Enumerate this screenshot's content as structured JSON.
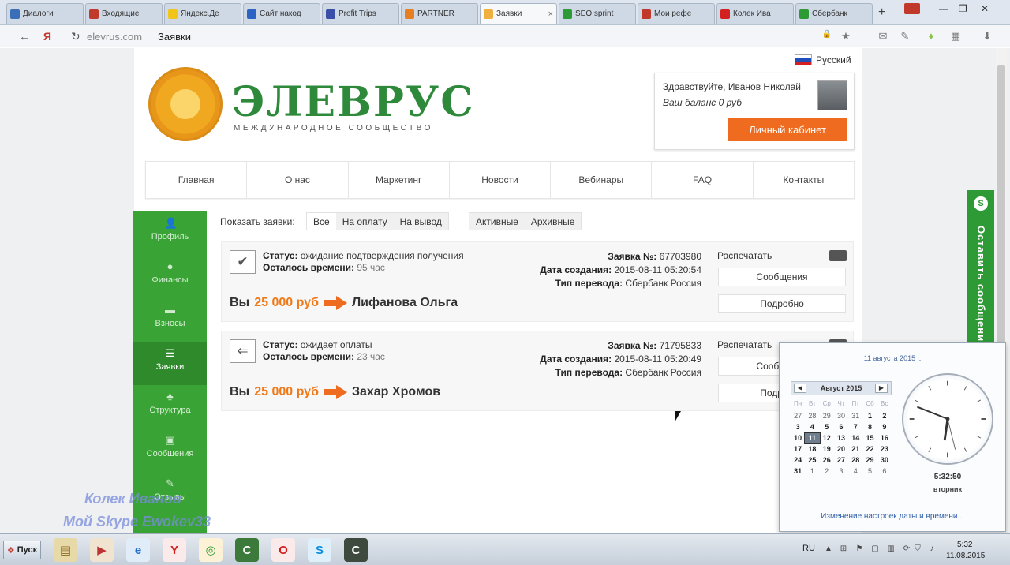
{
  "tabs": [
    {
      "label": "Диалоги",
      "color": "#3a6fb8"
    },
    {
      "label": "Входящие",
      "color": "#c0392b"
    },
    {
      "label": "Яндекс.Де",
      "color": "#f0c419"
    },
    {
      "label": "Сайт накод",
      "color": "#2b64c4"
    },
    {
      "label": "Profit Trips",
      "color": "#3b4fa8"
    },
    {
      "label": "PARTNER",
      "color": "#e67e22"
    },
    {
      "label": "Заявки",
      "color": "#f0b040"
    },
    {
      "label": "SEO sprint",
      "color": "#2e9a35"
    },
    {
      "label": "Мои рефе",
      "color": "#c0392b"
    },
    {
      "label": "Колек Ива",
      "color": "#d32020"
    },
    {
      "label": "Сбербанк",
      "color": "#2e9a35"
    }
  ],
  "active_tab_close": "×",
  "new_tab": "+",
  "window_buttons": {
    "minimize": "—",
    "restore": "❐",
    "close": "✕"
  },
  "address": {
    "back": "←",
    "ya": "Я",
    "reload": "↻",
    "domain": "elevrus.com",
    "title": "Заявки",
    "lock": "🔒",
    "star": "★",
    "download": "⬇"
  },
  "site": {
    "language": "Русский",
    "logo_name": "ЭЛЕВРУС",
    "logo_subtitle": "МЕЖДУНАРОДНОЕ СООБЩЕСТВО",
    "greeting": "Здравствуйте, Иванов Николай",
    "balance": "Ваш баланс 0 руб",
    "cabinet_button": "Личный кабинет",
    "nav": [
      "Главная",
      "О нас",
      "Маркетинг",
      "Новости",
      "Вебинары",
      "FAQ",
      "Контакты"
    ],
    "sidebar": [
      {
        "label": "Профиль",
        "icon": "person-icon",
        "glyph": "👤"
      },
      {
        "label": "Финансы",
        "icon": "coin-icon",
        "glyph": "●"
      },
      {
        "label": "Взносы",
        "icon": "card-icon",
        "glyph": "▬"
      },
      {
        "label": "Заявки",
        "icon": "list-icon",
        "glyph": "☰"
      },
      {
        "label": "Структура",
        "icon": "structure-icon",
        "glyph": "♣"
      },
      {
        "label": "Сообщения",
        "icon": "messages-icon",
        "glyph": "▣"
      },
      {
        "label": "Отзывы",
        "icon": "pen-icon",
        "glyph": "✎"
      }
    ],
    "active_sidebar": "Заявки",
    "filter_label": "Показать заявки:",
    "filter_type": [
      "Все",
      "На оплату",
      "На вывод"
    ],
    "filter_state": [
      "Активные",
      "Архивные"
    ],
    "orders": [
      {
        "status_label": "Статус:",
        "status": "ожидание подтверждения получения",
        "time_label": "Осталось времени:",
        "time": "95 час",
        "you": "Вы",
        "amount": "25 000 руб",
        "recipient": "Лифанова Ольга",
        "number_label": "Заявка №:",
        "number": "67703980",
        "created_label": "Дата создания:",
        "created": "2015-08-11 05:20:54",
        "transfer_label": "Тип перевода:",
        "transfer": "Сбербанк Россия",
        "print": "Распечатать",
        "messages_btn": "Сообщения",
        "details_btn": "Подробно",
        "icon": "check-icon",
        "glyph": "✔"
      },
      {
        "status_label": "Статус:",
        "status": "ожидает оплаты",
        "time_label": "Осталось времени:",
        "time": "23 час",
        "you": "Вы",
        "amount": "25 000 руб",
        "recipient": "Захар Хромов",
        "number_label": "Заявка №:",
        "number": "71795833",
        "created_label": "Дата создания:",
        "created": "2015-08-11 05:20:49",
        "transfer_label": "Тип перевода:",
        "transfer": "Сбербанк Россия",
        "print": "Распечатать",
        "messages_btn": "Сообщения",
        "details_btn": "Подробно",
        "icon": "reply-arrow-icon",
        "glyph": "⇐"
      }
    ],
    "feedback_tab": "Оставить сообщение",
    "feedback_icon": "S"
  },
  "watermark": {
    "line1": "Колек Иванов",
    "line2": "Мой Skype Ewokev33"
  },
  "calendar": {
    "date_header": "11 августа 2015 г.",
    "month": "Август 2015",
    "prev": "◀",
    "next": "▶",
    "weekdays": [
      "Пн",
      "Вт",
      "Ср",
      "Чт",
      "Пт",
      "Сб",
      "Вс"
    ],
    "days": [
      {
        "d": "27",
        "other": true
      },
      {
        "d": "28",
        "other": true
      },
      {
        "d": "29",
        "other": true
      },
      {
        "d": "30",
        "other": true
      },
      {
        "d": "31",
        "other": true
      },
      {
        "d": "1"
      },
      {
        "d": "2"
      },
      {
        "d": "3"
      },
      {
        "d": "4"
      },
      {
        "d": "5"
      },
      {
        "d": "6"
      },
      {
        "d": "7"
      },
      {
        "d": "8"
      },
      {
        "d": "9"
      },
      {
        "d": "10"
      },
      {
        "d": "11",
        "today": true
      },
      {
        "d": "12"
      },
      {
        "d": "13"
      },
      {
        "d": "14"
      },
      {
        "d": "15"
      },
      {
        "d": "16"
      },
      {
        "d": "17"
      },
      {
        "d": "18"
      },
      {
        "d": "19"
      },
      {
        "d": "20"
      },
      {
        "d": "21"
      },
      {
        "d": "22"
      },
      {
        "d": "23"
      },
      {
        "d": "24"
      },
      {
        "d": "25"
      },
      {
        "d": "26"
      },
      {
        "d": "27"
      },
      {
        "d": "28"
      },
      {
        "d": "29"
      },
      {
        "d": "30"
      },
      {
        "d": "31"
      },
      {
        "d": "1",
        "other": true
      },
      {
        "d": "2",
        "other": true
      },
      {
        "d": "3",
        "other": true
      },
      {
        "d": "4",
        "other": true
      },
      {
        "d": "5",
        "other": true
      },
      {
        "d": "6",
        "other": true
      }
    ],
    "time": "5:32:50",
    "weekday": "вторник",
    "settings_link": "Изменение настроек даты и времени..."
  },
  "taskbar": {
    "start": "Пуск",
    "apps": [
      {
        "name": "explorer-icon",
        "glyph": "▤",
        "bg": "#e8d9a8",
        "fg": "#8a6a1f"
      },
      {
        "name": "media-player-icon",
        "glyph": "▶",
        "bg": "#f0e4d0",
        "fg": "#b33"
      },
      {
        "name": "internet-explorer-icon",
        "glyph": "e",
        "bg": "#e0ecf8",
        "fg": "#1f6fd0"
      },
      {
        "name": "yandex-browser-icon",
        "glyph": "Y",
        "bg": "#fbeaea",
        "fg": "#d31d1d"
      },
      {
        "name": "chrome-icon",
        "glyph": "◎",
        "bg": "#fdf2d6",
        "fg": "#2e9a35"
      },
      {
        "name": "camtasia-icon",
        "glyph": "C",
        "bg": "#3b7a3b",
        "fg": "#fff"
      },
      {
        "name": "opera-icon",
        "glyph": "O",
        "bg": "#fbeaea",
        "fg": "#d31d1d"
      },
      {
        "name": "skype-icon",
        "glyph": "S",
        "bg": "#e0f0fb",
        "fg": "#0a8de0"
      },
      {
        "name": "camtasia-recorder-icon",
        "glyph": "C",
        "bg": "#3e4a3e",
        "fg": "#fff"
      }
    ],
    "lang": "RU",
    "time": "5:32",
    "date": "11.08.2015"
  }
}
